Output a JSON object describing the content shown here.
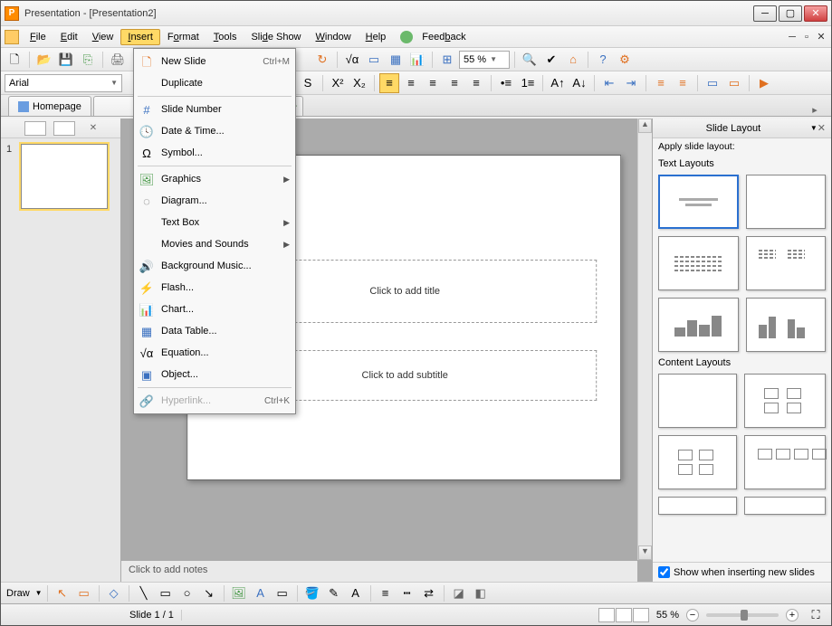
{
  "titlebar": {
    "title": "Presentation - [Presentation2]"
  },
  "menubar": {
    "items": [
      "File",
      "Edit",
      "View",
      "Insert",
      "Format",
      "Tools",
      "Slide Show",
      "Window",
      "Help",
      "Feedback"
    ],
    "active_index": 3
  },
  "toolbar1": {
    "zoom_value": "55 %"
  },
  "toolbar2": {
    "font_name": "Arial"
  },
  "tabs": {
    "items": [
      {
        "label": "Homepage",
        "closable": false
      },
      {
        "label": "",
        "closable": true
      }
    ]
  },
  "slide_panel": {
    "thumbs": [
      {
        "number": "1"
      }
    ]
  },
  "editor": {
    "title_placeholder": "Click to add title",
    "subtitle_placeholder": "Click to add subtitle",
    "notes_placeholder": "Click to add notes"
  },
  "insert_menu": {
    "items": [
      {
        "icon": "📄",
        "label": "New Slide",
        "shortcut": "Ctrl+M"
      },
      {
        "icon": "",
        "label": "Duplicate"
      },
      {
        "sep": true
      },
      {
        "icon": "#",
        "label": "Slide Number"
      },
      {
        "icon": "🕓",
        "label": "Date & Time..."
      },
      {
        "icon": "Ω",
        "label": "Symbol..."
      },
      {
        "sep": true
      },
      {
        "icon": "🖼",
        "label": "Graphics",
        "submenu": true
      },
      {
        "icon": "◌",
        "label": "Diagram..."
      },
      {
        "icon": "",
        "label": "Text Box",
        "submenu": true
      },
      {
        "icon": "",
        "label": "Movies and Sounds",
        "submenu": true
      },
      {
        "icon": "🔊",
        "label": "Background Music...",
        "icon_color": "orange"
      },
      {
        "icon": "⚡",
        "label": "Flash...",
        "icon_color": "blue"
      },
      {
        "icon": "📊",
        "label": "Chart...",
        "icon_color": "orange"
      },
      {
        "icon": "▦",
        "label": "Data Table...",
        "icon_color": "blue"
      },
      {
        "icon": "√α",
        "label": "Equation..."
      },
      {
        "icon": "▣",
        "label": "Object...",
        "icon_color": "blue"
      },
      {
        "sep": true
      },
      {
        "icon": "🔗",
        "label": "Hyperlink...",
        "shortcut": "Ctrl+K",
        "disabled": true
      }
    ]
  },
  "layout_panel": {
    "title": "Slide Layout",
    "subtitle": "Apply slide layout:",
    "sections": {
      "text": "Text Layouts",
      "content": "Content Layouts"
    },
    "footer_checkbox": "Show when inserting new slides",
    "footer_checked": true
  },
  "draw_toolbar": {
    "label": "Draw"
  },
  "statusbar": {
    "slide_info": "Slide 1 / 1",
    "zoom_value": "55 %"
  }
}
